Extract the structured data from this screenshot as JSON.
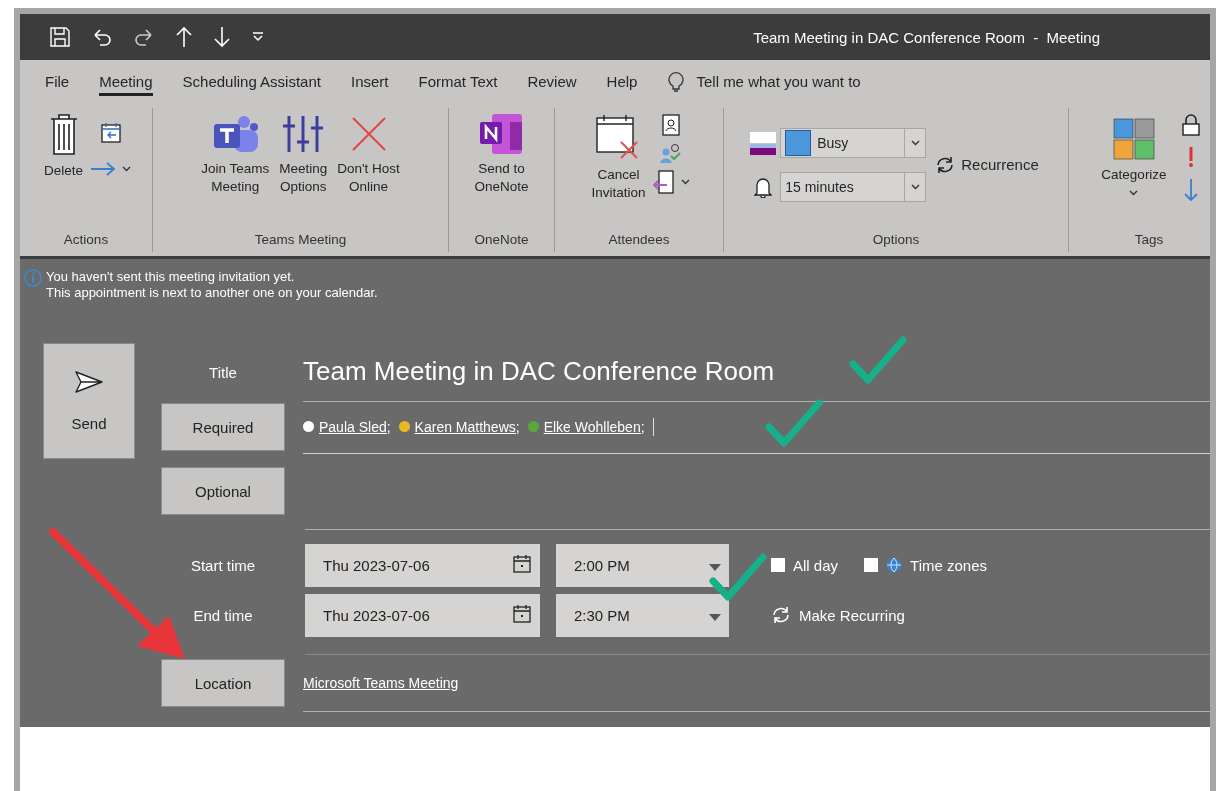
{
  "window": {
    "title": "Team Meeting in DAC Conference Room  -  Meeting"
  },
  "tabs": [
    {
      "label": "File",
      "selected": false
    },
    {
      "label": "Meeting",
      "selected": true
    },
    {
      "label": "Scheduling Assistant",
      "selected": false
    },
    {
      "label": "Insert",
      "selected": false
    },
    {
      "label": "Format Text",
      "selected": false
    },
    {
      "label": "Review",
      "selected": false
    },
    {
      "label": "Help",
      "selected": false
    }
  ],
  "tell_me": {
    "placeholder": "Tell me what you want to"
  },
  "ribbon": {
    "groups": [
      {
        "label": "Actions",
        "buttons": [
          "Delete"
        ]
      },
      {
        "label": "Teams Meeting",
        "buttons": [
          "Join Teams\nMeeting",
          "Meeting\nOptions",
          "Don't Host\nOnline"
        ]
      },
      {
        "label": "OneNote",
        "buttons": [
          "Send to\nOneNote"
        ]
      },
      {
        "label": "Attendees",
        "buttons": [
          "Cancel\nInvitation"
        ]
      },
      {
        "label": "Options",
        "show_as": "Busy",
        "reminder": "15 minutes",
        "recurrence": "Recurrence"
      },
      {
        "label": "Tags",
        "buttons": [
          "Categorize"
        ]
      }
    ]
  },
  "info_bar": {
    "lines": [
      "You haven't sent this meeting invitation yet.",
      "This appointment is next to another one on your calendar."
    ]
  },
  "form": {
    "send": "Send",
    "title_label": "Title",
    "title": "Team Meeting in DAC Conference Room",
    "required_button": "Required",
    "attendees": [
      {
        "name": "Paula Sled;",
        "color": "#ffffff"
      },
      {
        "name": "Karen Matthews;",
        "color": "#e8b923"
      },
      {
        "name": "Elke Wohlleben;",
        "color": "#5aa83a"
      }
    ],
    "optional_button": "Optional",
    "start": {
      "label": "Start time",
      "date": "Thu 2023-07-06",
      "time": "2:00 PM"
    },
    "end": {
      "label": "End time",
      "date": "Thu 2023-07-06",
      "time": "2:30 PM"
    },
    "all_day": {
      "label": "All day",
      "checked": false
    },
    "time_zones": {
      "label": "Time zones",
      "checked": false
    },
    "make_recurring": "Make Recurring",
    "location_button": "Location",
    "location": "Microsoft Teams Meeting"
  }
}
